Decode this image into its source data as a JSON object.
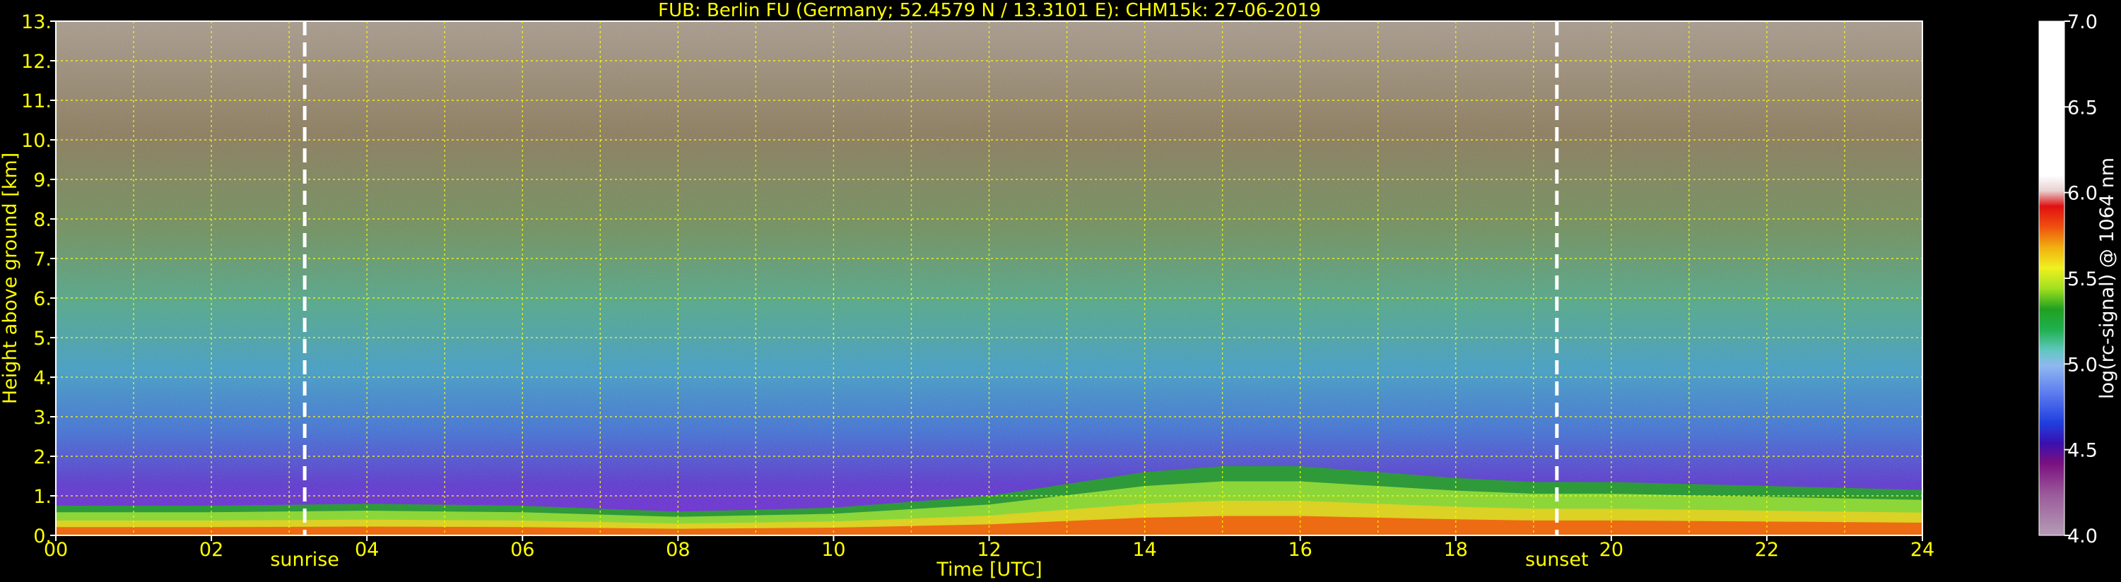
{
  "chart_data": {
    "type": "heatmap",
    "title": "FUB: Berlin FU (Germany; 52.4579 N / 13.3101 E):    CHM15k: 27-06-2019",
    "xlabel": "Time [UTC]",
    "ylabel": "Height above ground [km]",
    "xlim": [
      0,
      24
    ],
    "ylim": [
      0,
      13
    ],
    "x_ticks": [
      "00",
      "02",
      "04",
      "06",
      "08",
      "10",
      "12",
      "14",
      "16",
      "18",
      "20",
      "22",
      "24"
    ],
    "y_ticks": [
      "0.",
      "1.",
      "2.",
      "3.",
      "4.",
      "5.",
      "6.",
      "7.",
      "8.",
      "9.",
      "10.",
      "11.",
      "12.",
      "13."
    ],
    "grid": true,
    "markers": [
      {
        "label": "sunrise",
        "x": 3.2
      },
      {
        "label": "sunset",
        "x": 19.3
      }
    ],
    "colorbar": {
      "label": "log(rc-signal) @ 1064 nm",
      "range": [
        4.0,
        7.0
      ],
      "ticks": [
        "4.0",
        "4.5",
        "5.0",
        "5.5",
        "6.0",
        "6.5",
        "7.0"
      ]
    },
    "aerosol_layer_top_km": [
      {
        "x": 0,
        "y": 0.75
      },
      {
        "x": 2,
        "y": 0.75
      },
      {
        "x": 4,
        "y": 0.8
      },
      {
        "x": 6,
        "y": 0.75
      },
      {
        "x": 8,
        "y": 0.6
      },
      {
        "x": 10,
        "y": 0.7
      },
      {
        "x": 12,
        "y": 1.0
      },
      {
        "x": 14,
        "y": 1.6
      },
      {
        "x": 15,
        "y": 1.75
      },
      {
        "x": 16,
        "y": 1.75
      },
      {
        "x": 17,
        "y": 1.6
      },
      {
        "x": 18,
        "y": 1.45
      },
      {
        "x": 19,
        "y": 1.35
      },
      {
        "x": 20,
        "y": 1.35
      },
      {
        "x": 22,
        "y": 1.25
      },
      {
        "x": 24,
        "y": 1.15
      }
    ]
  }
}
